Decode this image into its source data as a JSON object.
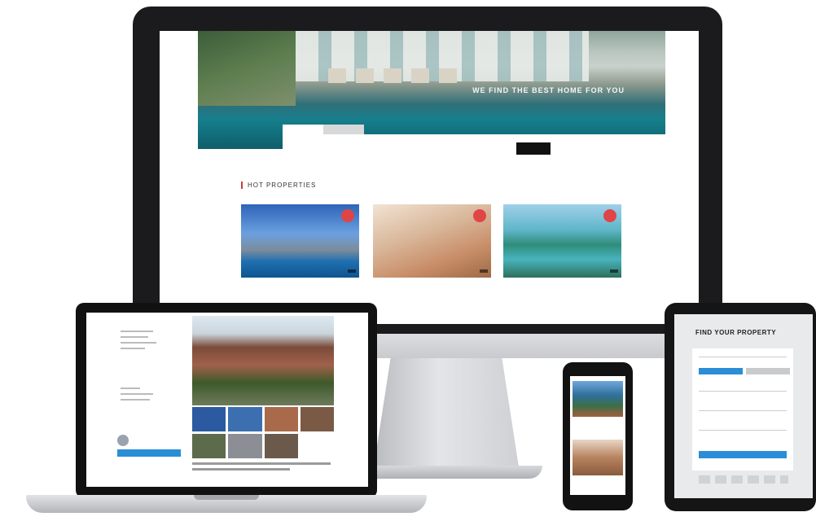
{
  "desktop": {
    "hero_headline": "WE FIND THE BEST HOME FOR YOU",
    "hero_caption": "",
    "search": {
      "tabs": [
        "",
        ""
      ],
      "fields": [
        "",
        "",
        "",
        ""
      ],
      "button": ""
    },
    "section_title": "HOT PROPERTIES",
    "cards": [
      {
        "badge": "",
        "price_tag": "",
        "meta_left": "",
        "meta_right": "",
        "name": "",
        "sub": ""
      },
      {
        "badge": "",
        "price_tag": "",
        "meta_left": "",
        "meta_right": "",
        "name": "",
        "sub": ""
      },
      {
        "badge": "",
        "price_tag": "",
        "meta_left": "",
        "meta_right": "",
        "name": "",
        "sub": ""
      }
    ]
  },
  "laptop": {
    "listing_title": "",
    "price": "",
    "agent_name": ""
  },
  "phone": {
    "header": "",
    "captions": [
      "",
      ""
    ]
  },
  "tablet": {
    "title": "FIND YOUR PROPERTY"
  }
}
